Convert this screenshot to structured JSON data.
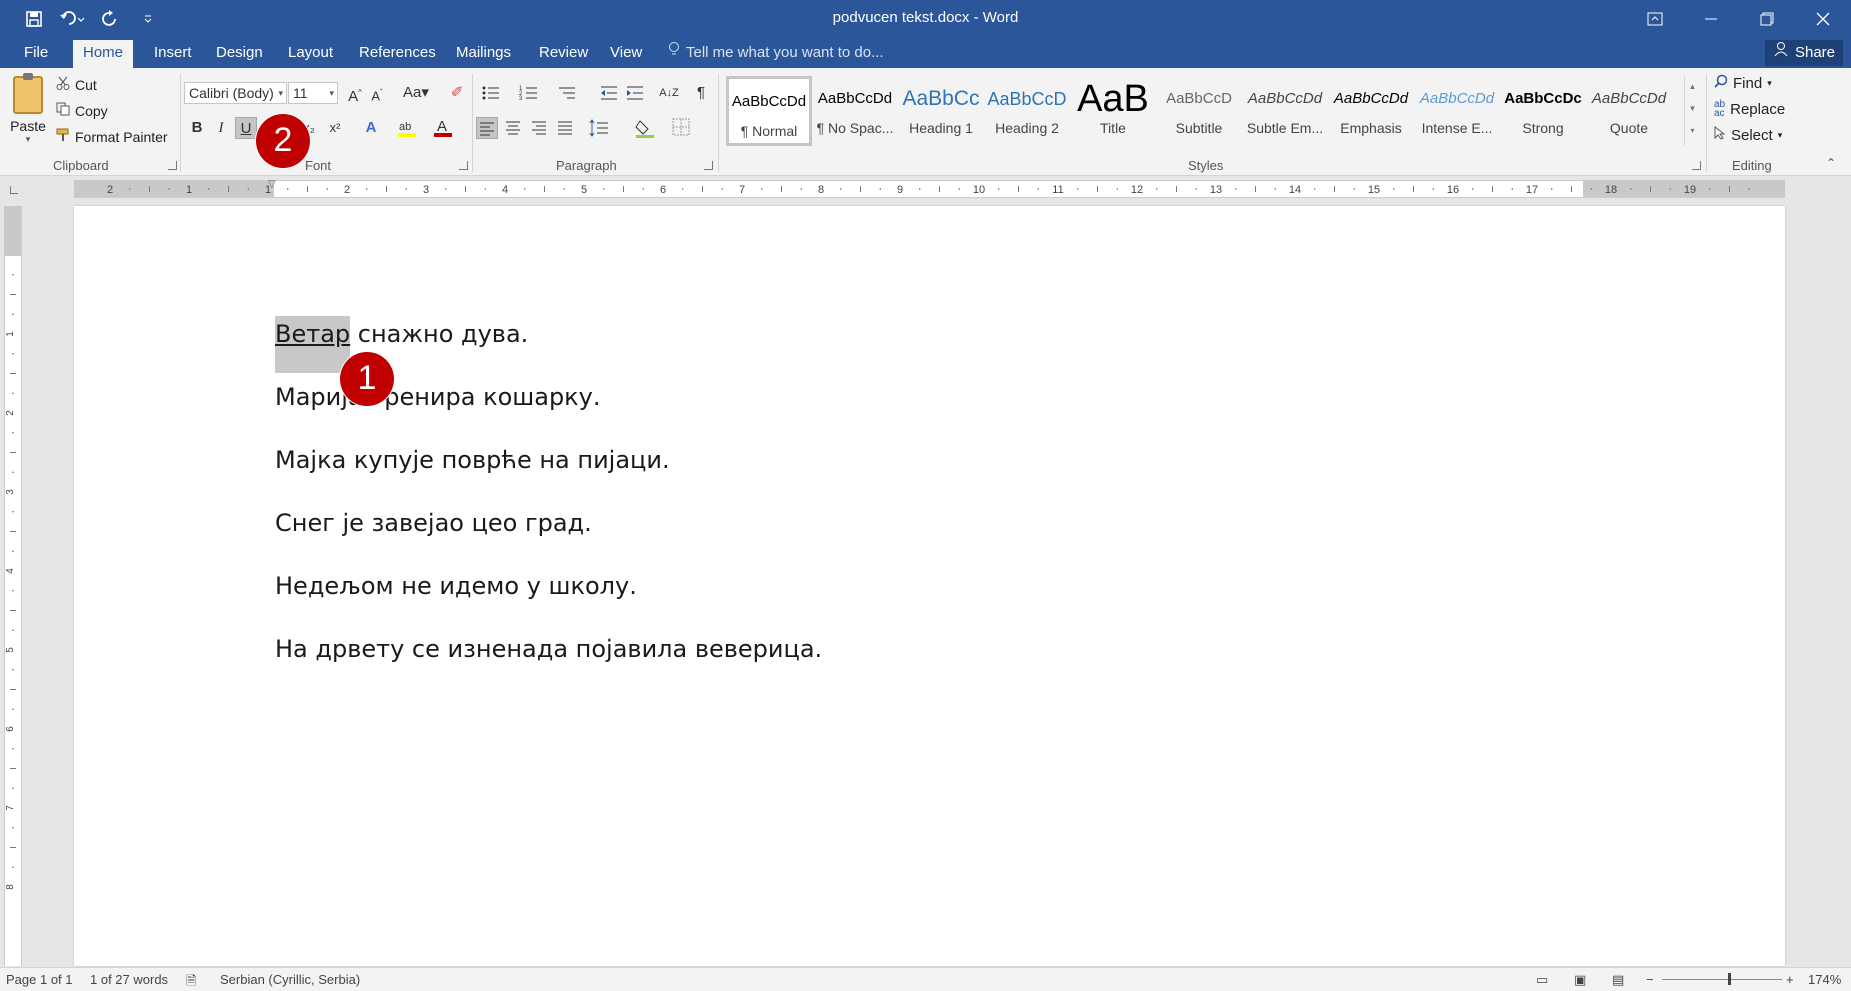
{
  "window": {
    "title": "podvucen tekst.docx - Word"
  },
  "tabs": [
    {
      "label": "File"
    },
    {
      "label": "Home"
    },
    {
      "label": "Insert"
    },
    {
      "label": "Design"
    },
    {
      "label": "Layout"
    },
    {
      "label": "References"
    },
    {
      "label": "Mailings"
    },
    {
      "label": "Review"
    },
    {
      "label": "View"
    }
  ],
  "tell_me": "Tell me what you want to do...",
  "share_label": "Share",
  "clipboard": {
    "paste": "Paste",
    "cut": "Cut",
    "copy": "Copy",
    "format_painter": "Format Painter",
    "group_label": "Clipboard"
  },
  "font": {
    "name": "Calibri (Body)",
    "size": "11",
    "group_label": "Font",
    "bold": "B",
    "italic": "I",
    "underline": "U",
    "subscript": "x₂",
    "superscript": "x²"
  },
  "paragraph": {
    "group_label": "Paragraph"
  },
  "styles": {
    "group_label": "Styles",
    "items": [
      {
        "preview": "AaBbCcDd",
        "name": "¶ Normal"
      },
      {
        "preview": "AaBbCcDd",
        "name": "¶ No Spac..."
      },
      {
        "preview": "AaBbCc",
        "name": "Heading 1"
      },
      {
        "preview": "AaBbCcD",
        "name": "Heading 2"
      },
      {
        "preview": "AaB",
        "name": "Title"
      },
      {
        "preview": "AaBbCcD",
        "name": "Subtitle"
      },
      {
        "preview": "AaBbCcDd",
        "name": "Subtle Em..."
      },
      {
        "preview": "AaBbCcDd",
        "name": "Emphasis"
      },
      {
        "preview": "AaBbCcDd",
        "name": "Intense E..."
      },
      {
        "preview": "AaBbCcDc",
        "name": "Strong"
      },
      {
        "preview": "AaBbCcDd",
        "name": "Quote"
      }
    ]
  },
  "editing": {
    "find": "Find",
    "replace": "Replace",
    "select": "Select",
    "group_label": "Editing"
  },
  "document": {
    "line1_selected": "Ветар",
    "line1_rest": " снажно дува.",
    "lines": [
      "Марија тренира кошарку.",
      "Мајка купује поврће на пијаци.",
      "Снег је завејао цео град.",
      "Недељом не идемо у школу.",
      "На дрвету се изненада појавила веверица."
    ]
  },
  "ruler": {
    "h_numbers": [
      "2",
      "1",
      "1",
      "2",
      "3",
      "4",
      "5",
      "6",
      "7",
      "8",
      "9",
      "10",
      "11",
      "12",
      "13",
      "14",
      "15",
      "16",
      "17",
      "18",
      "19"
    ],
    "v_numbers": [
      "1",
      "2",
      "3",
      "4",
      "5",
      "6",
      "7",
      "8"
    ]
  },
  "markers": {
    "one": "1",
    "two": "2"
  },
  "status": {
    "page": "Page 1 of 1",
    "words": "1 of 27 words",
    "language": "Serbian (Cyrillic, Serbia)",
    "zoom": "174%"
  },
  "colors": {
    "accent": "#2b579a",
    "marker": "#c00000",
    "selection": "#c8c8c8"
  }
}
